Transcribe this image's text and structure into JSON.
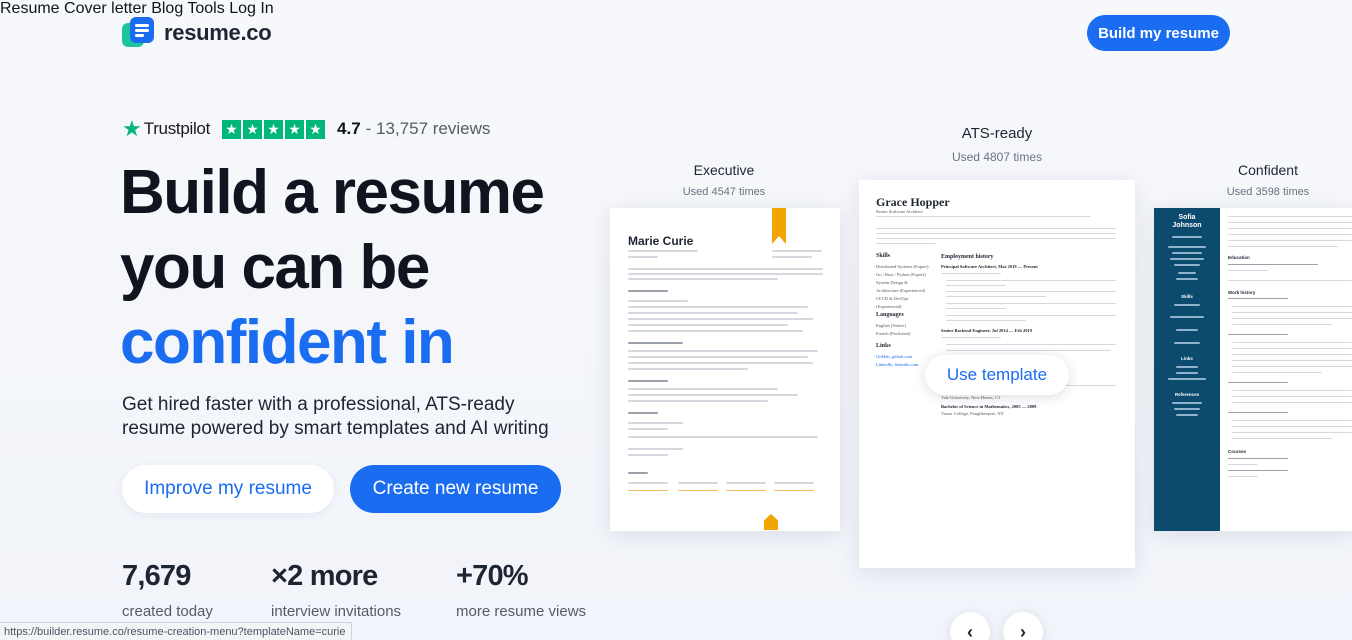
{
  "brand": {
    "name": "resume.co"
  },
  "nav": [
    {
      "label": "Resume"
    },
    {
      "label": "Cover letter"
    },
    {
      "label": "Blog"
    },
    {
      "label": "Tools"
    },
    {
      "label": "Log In"
    }
  ],
  "header": {
    "cta_label": "Build my resume"
  },
  "trustpilot": {
    "brand": "Trustpilot",
    "rating": "4.7",
    "reviews": "- 13,757 reviews",
    "stars": 5,
    "star_color": "#00b67a"
  },
  "hero": {
    "headline_line1": "Build a resume",
    "headline_line2": "you can be",
    "headline_line3": "confident in",
    "subheadline_line1": "Get hired faster with a professional, ATS-ready",
    "subheadline_line2": "resume powered by smart templates and AI writing",
    "improve_label": "Improve my resume",
    "create_label": "Create new resume"
  },
  "stats": [
    {
      "value": "7,679",
      "label": "created today"
    },
    {
      "value": "×2 more",
      "label": "interview invitations"
    },
    {
      "value": "+70%",
      "label": "more resume views"
    }
  ],
  "templates": {
    "executive": {
      "title": "Executive",
      "usage": "Used 4547 times",
      "person": "Marie Curie"
    },
    "ats": {
      "title": "ATS-ready",
      "usage": "Used 4807 times",
      "person": "Grace Hopper",
      "role": "Senior Software Architect",
      "sections": {
        "skills": "Skills",
        "employment": "Employment history",
        "languages": "Languages",
        "links": "Links"
      },
      "job1": "Principal Software Architect, Mar 2019 — Present",
      "job2": "Senior Backend Engineer, Jul 2014 — Feb 2019",
      "degree": "Bachelor of Science in Mathematics, 2005 — 2009",
      "school1": "Yale University, New Haven, CT",
      "school2": "Vassar College, Poughkeepsie, NY",
      "skills_list": [
        "Distributed Systems (Expert)",
        "Go / Rust / Python (Expert)",
        "System Design &",
        "Architecture (Experienced)",
        "CI/CD & DevOps",
        "(Experienced)"
      ],
      "languages_list": [
        "English (Native)",
        "French (Proficient)"
      ],
      "links_list": [
        "GitHub, github.com",
        "LinkedIn, linkedin.com"
      ],
      "use_template_label": "Use template"
    },
    "confident": {
      "title": "Confident",
      "usage": "Used 3598 times",
      "first_name": "Sofia",
      "last_name": "Johnson",
      "sections": {
        "skills": "Skills",
        "links": "Links",
        "references": "References",
        "education": "Education",
        "work": "Work history",
        "courses": "Courses"
      }
    }
  },
  "carousel": {
    "prev_icon": "chevron-left-icon",
    "next_icon": "chevron-right-icon"
  },
  "status_bar": {
    "url": "https://builder.resume.co/resume-creation-menu?templateName=curie"
  },
  "colors": {
    "accent": "#1a6cf0",
    "text": "#0f141e",
    "trust_green": "#00b67a"
  }
}
